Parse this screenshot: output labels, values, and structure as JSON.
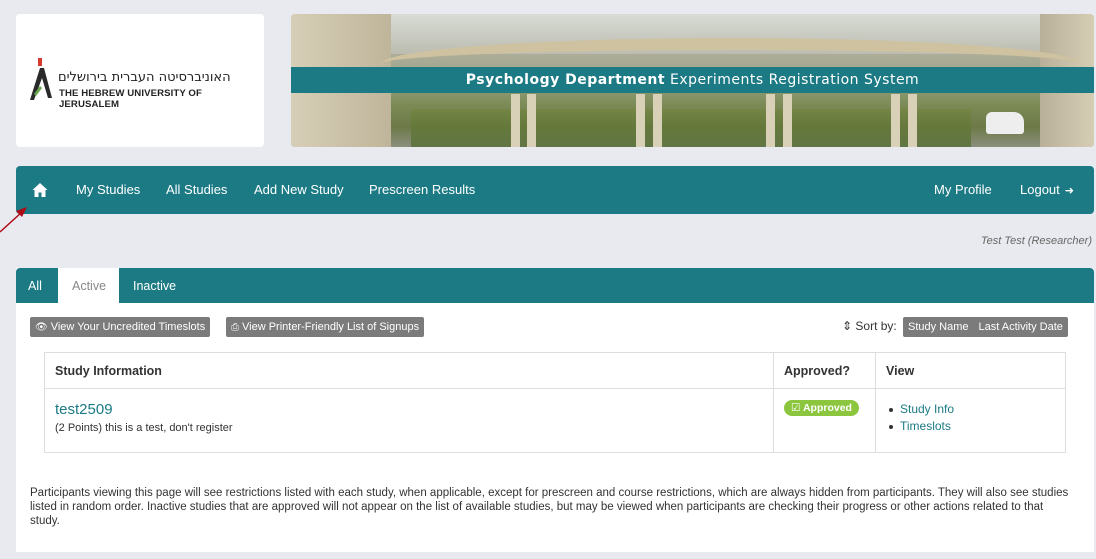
{
  "logo": {
    "hebrew": "האוניברסיטה העברית בירושלים",
    "english": "THE HEBREW UNIVERSITY OF JERUSALEM"
  },
  "banner": {
    "title_bold": "Psychology Department",
    "title_rest": " Experiments Registration System"
  },
  "nav": {
    "items": [
      {
        "label": "My Studies"
      },
      {
        "label": "All Studies"
      },
      {
        "label": "Add New Study"
      },
      {
        "label": "Prescreen Results"
      }
    ],
    "right": [
      {
        "label": "My Profile"
      },
      {
        "label": "Logout"
      }
    ]
  },
  "user": "Test Test (Researcher)",
  "tabs": [
    {
      "label": "All"
    },
    {
      "label": "Active"
    },
    {
      "label": "Inactive"
    }
  ],
  "toolbar": {
    "uncredited_label": "View Your Uncredited Timeslots",
    "printer_label": "View Printer-Friendly List of Signups",
    "sort_label": "Sort by:",
    "sort_options": [
      "Study Name",
      "Last Activity Date"
    ]
  },
  "table": {
    "headers": [
      "Study Information",
      "Approved?",
      "View"
    ],
    "rows": [
      {
        "name": "test2509",
        "description": "(2 Points) this is a test, don't register",
        "approved": "Approved",
        "links": [
          "Study Info",
          "Timeslots"
        ]
      }
    ]
  },
  "footer_note": "Participants viewing this page will see restrictions listed with each study, when applicable, except for prescreen and course restrictions, which are always hidden from participants. They will also see studies listed in random order.  Inactive studies that are approved will not appear on the list of available studies, but may be viewed when participants are checking their progress or other actions related to that study.",
  "colors": {
    "teal": "#1c7a84",
    "approved_green": "#8cc63f",
    "button_gray": "#7b7b7b",
    "annotation_arrow": "#b00a16"
  },
  "icons": [
    "home-icon",
    "logout-icon",
    "eye-icon",
    "print-icon",
    "sort-icon",
    "check-square-icon",
    "annotation-arrow"
  ]
}
